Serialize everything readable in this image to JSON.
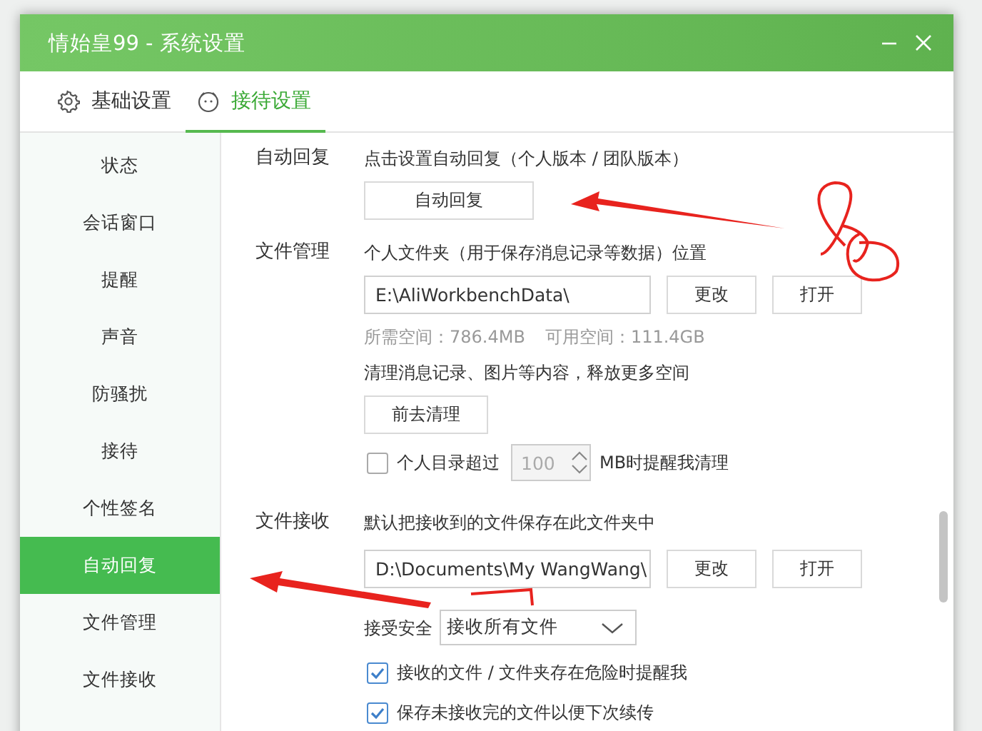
{
  "window": {
    "title": "情始皇99 - 系统设置"
  },
  "tabs": [
    {
      "label": "基础设置",
      "selected": false
    },
    {
      "label": "接待设置",
      "selected": true
    }
  ],
  "sidebar": {
    "items": [
      {
        "label": "状态",
        "selected": false
      },
      {
        "label": "会话窗口",
        "selected": false
      },
      {
        "label": "提醒",
        "selected": false
      },
      {
        "label": "声音",
        "selected": false
      },
      {
        "label": "防骚扰",
        "selected": false
      },
      {
        "label": "接待",
        "selected": false
      },
      {
        "label": "个性签名",
        "selected": false
      },
      {
        "label": "自动回复",
        "selected": true
      },
      {
        "label": "文件管理",
        "selected": false
      },
      {
        "label": "文件接收",
        "selected": false
      }
    ]
  },
  "sections": [
    {
      "label": "自动回复",
      "rows": [
        {
          "kind": "text",
          "text": "点击设置自动回复（个人版本 / 团队版本）"
        },
        {
          "kind": "button",
          "label": "自动回复"
        }
      ]
    },
    {
      "label": "文件管理",
      "rows": [
        {
          "kind": "text",
          "text": "个人文件夹（用于保存消息记录等数据）位置"
        },
        {
          "kind": "path",
          "value": "E:\\AliWorkbenchData\\",
          "buttons": [
            "更改",
            "打开"
          ]
        },
        {
          "kind": "notes",
          "items": [
            "所需空间：786.4MB",
            "可用空间：111.4GB"
          ]
        },
        {
          "kind": "text",
          "text": "清理消息记录、图片等内容，释放更多空间"
        },
        {
          "kind": "button",
          "label": "前去清理"
        },
        {
          "kind": "threshold",
          "checked": false,
          "label": "个人目录超过",
          "value": "100",
          "unit": "MB时提醒我清理"
        }
      ]
    },
    {
      "label": "文件接收",
      "rows": [
        {
          "kind": "text",
          "text": "默认把接收到的文件保存在此文件夹中"
        },
        {
          "kind": "path",
          "value": "D:\\Documents\\My WangWang\\",
          "buttons": [
            "更改",
            "打开"
          ]
        },
        {
          "kind": "select",
          "label": "接受安全",
          "value": "接收所有文件"
        },
        {
          "kind": "checkbox",
          "checked": true,
          "label": "接收的文件 / 文件夹存在危险时提醒我"
        },
        {
          "kind": "checkbox",
          "checked": true,
          "label": "保存未接收完的文件以便下次续传"
        }
      ]
    }
  ]
}
